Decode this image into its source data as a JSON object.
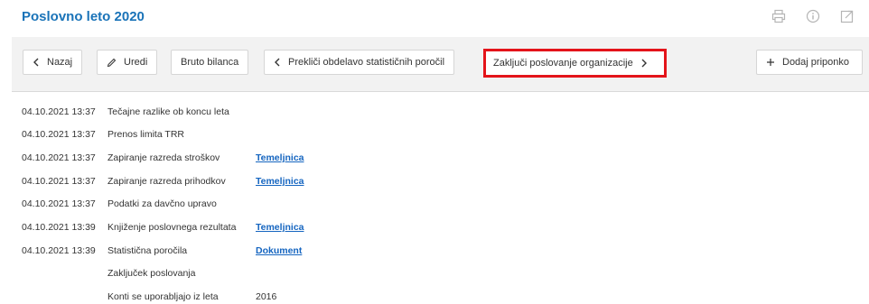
{
  "header": {
    "title": "Poslovno leto 2020"
  },
  "top_icons": [
    "print-icon",
    "info-icon",
    "export-icon"
  ],
  "toolbar": {
    "back_label": "Nazaj",
    "edit_label": "Uredi",
    "gross_balance_label": "Bruto bilanca",
    "cancel_stat_label": "Prekliči obdelavo statističnih poročil",
    "close_business_label": "Zaključi poslovanje organizacije",
    "add_attachment_label": "Dodaj priponko"
  },
  "highlight_color": "#e4141a",
  "accent_color": "#1a73b8",
  "log": [
    {
      "timestamp": "04.10.2021 13:37",
      "description": "Tečajne razlike ob koncu leta",
      "link": ""
    },
    {
      "timestamp": "04.10.2021 13:37",
      "description": "Prenos limita TRR",
      "link": ""
    },
    {
      "timestamp": "04.10.2021 13:37",
      "description": "Zapiranje razreda stroškov",
      "link": "Temeljnica"
    },
    {
      "timestamp": "04.10.2021 13:37",
      "description": "Zapiranje razreda prihodkov",
      "link": "Temeljnica"
    },
    {
      "timestamp": "04.10.2021 13:37",
      "description": "Podatki za davčno upravo",
      "link": ""
    },
    {
      "timestamp": "04.10.2021 13:39",
      "description": "Knjiženje poslovnega rezultata",
      "link": "Temeljnica"
    },
    {
      "timestamp": "04.10.2021 13:39",
      "description": "Statistična poročila",
      "link": "Dokument"
    },
    {
      "timestamp": "",
      "description": "Zaključek poslovanja",
      "link": ""
    },
    {
      "timestamp": "",
      "description": "Konti se uporabljajo iz leta",
      "value": "2016"
    }
  ]
}
